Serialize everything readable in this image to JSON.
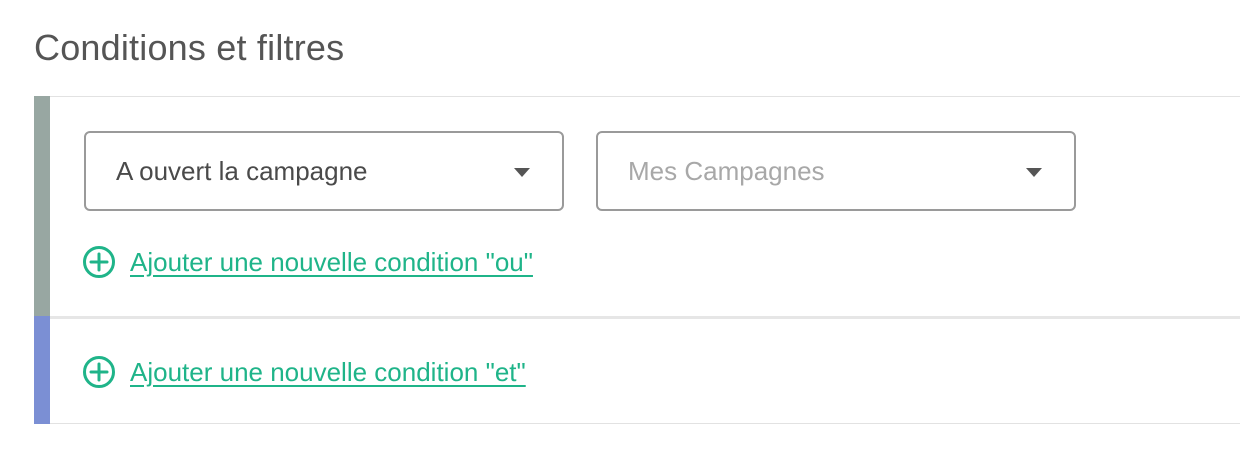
{
  "page": {
    "title": "Conditions et filtres"
  },
  "or_group": {
    "accent_color": "#98a7a2",
    "condition_select": {
      "value": "A ouvert la campagne"
    },
    "campaign_select": {
      "placeholder": "Mes Campagnes"
    },
    "add_or_label": "Ajouter une nouvelle condition \"ou\""
  },
  "and_group": {
    "accent_color": "#7b8fd4",
    "add_and_label": "Ajouter une nouvelle condition \"et\""
  },
  "colors": {
    "link": "#1fb489",
    "select_border": "#9a9a9a",
    "title_text": "#555555"
  },
  "icons": {
    "add": "plus-circle-icon",
    "dropdown": "caret-down-icon"
  }
}
